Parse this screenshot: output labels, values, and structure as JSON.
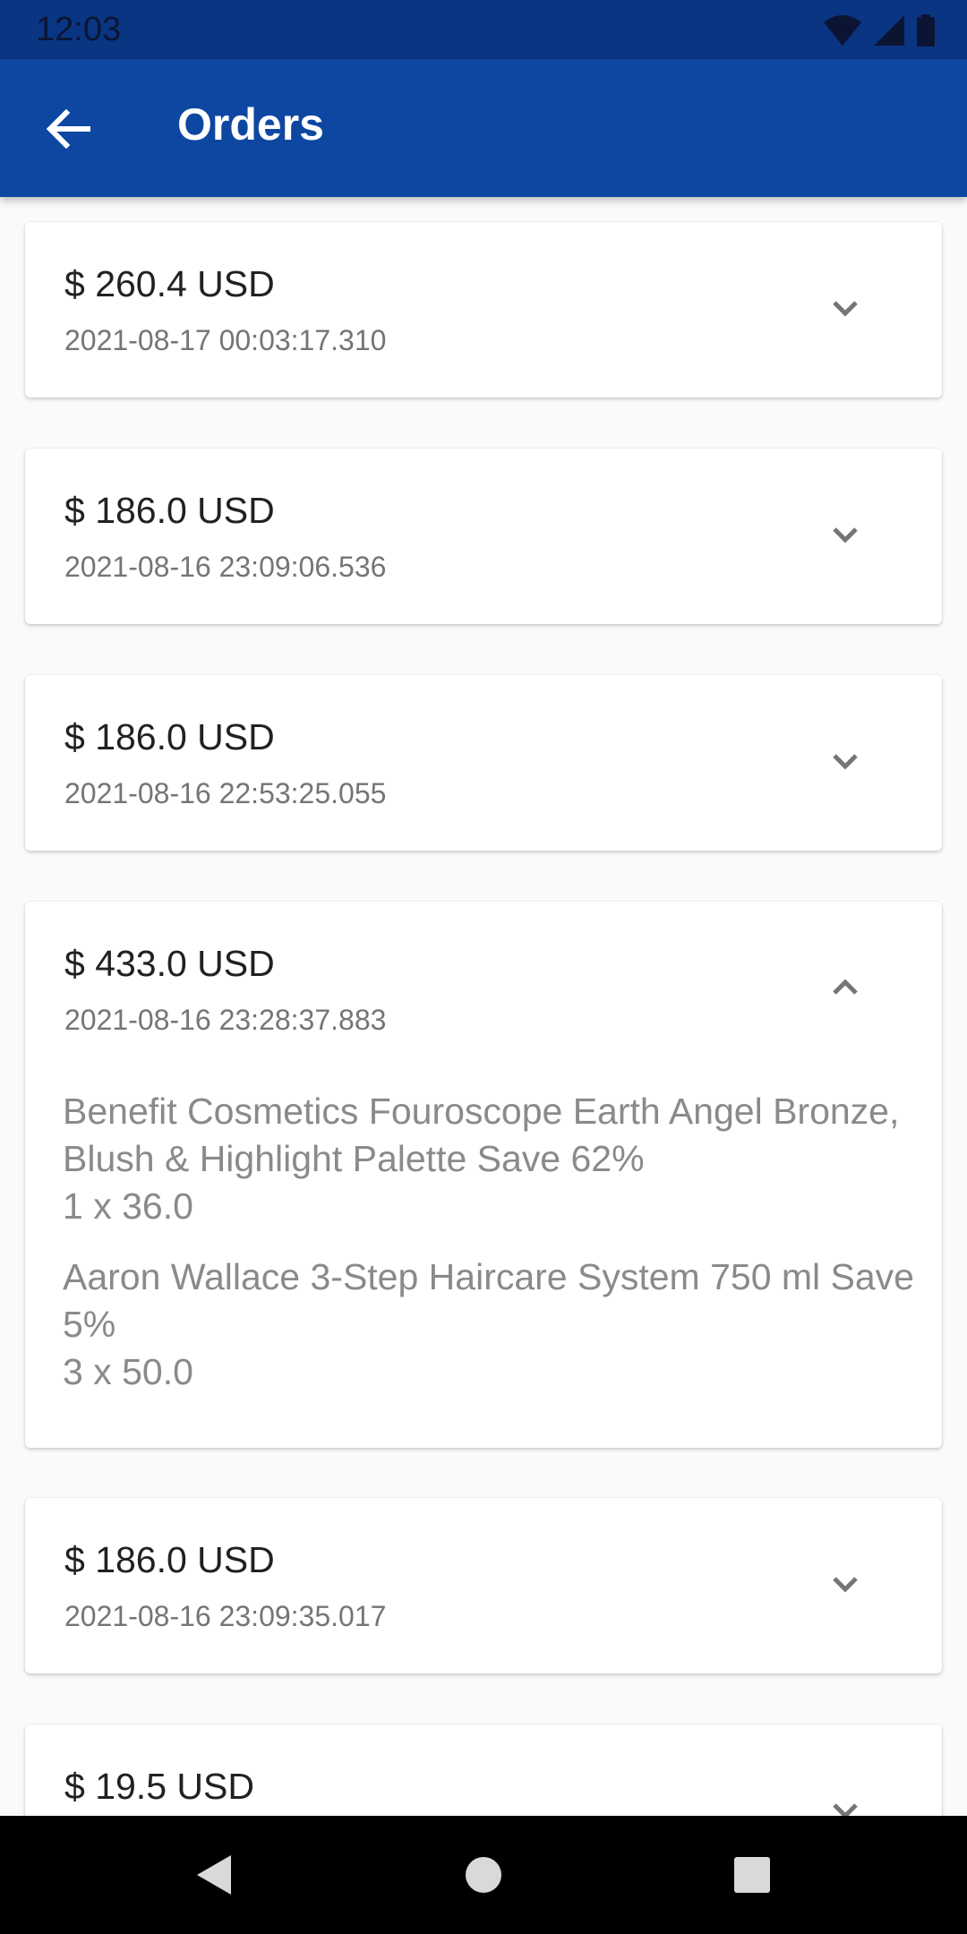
{
  "status_bar": {
    "time": "12:03"
  },
  "app_bar": {
    "title": "Orders"
  },
  "orders": [
    {
      "price": "$ 260.4 USD",
      "date": "2021-08-17 00:03:17.310",
      "expanded": false
    },
    {
      "price": "$ 186.0 USD",
      "date": "2021-08-16 23:09:06.536",
      "expanded": false
    },
    {
      "price": "$ 186.0 USD",
      "date": "2021-08-16 22:53:25.055",
      "expanded": false
    },
    {
      "price": "$ 433.0 USD",
      "date": "2021-08-16 23:28:37.883",
      "expanded": true,
      "items": [
        {
          "name": "Benefit Cosmetics Fouroscope Earth Angel Bronze, Blush & Highlight Palette Save 62%",
          "qty": "1 x 36.0"
        },
        {
          "name": "Aaron Wallace 3-Step Haircare System 750 ml Save 5%",
          "qty": "3 x 50.0"
        }
      ]
    },
    {
      "price": "$ 186.0 USD",
      "date": "2021-08-16 23:09:35.017",
      "expanded": false
    },
    {
      "price": "$ 19.5 USD",
      "date": "",
      "expanded": false
    }
  ],
  "icons": {
    "back": "arrow-back-icon",
    "expand": "chevron-down-icon",
    "collapse": "chevron-up-icon"
  },
  "colors": {
    "status_bar": "#0a3583",
    "app_bar": "#0d47a1",
    "background": "#fafafa"
  }
}
